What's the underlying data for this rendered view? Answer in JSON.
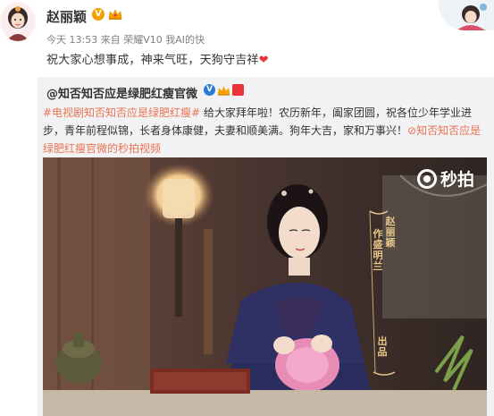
{
  "post": {
    "username": "赵丽颖",
    "verified_symbol": "V",
    "meta": "今天 13:53 来自 荣耀V10 我AI的快",
    "text": "祝大家心想事成，神来气旺，天狗守吉祥",
    "heart": "❤"
  },
  "repost": {
    "username": "@知否知否应是绿肥红瘦官微",
    "verified_symbol": "V",
    "tags": "#电视剧知否知否应是绿肥红瘦#",
    "body": " 给大家拜年啦！农历新年，阖家团圆，祝各位少年学业进步，青年前程似锦，长者身体康健，夫妻和顺美满。狗年大吉，家和万事兴！",
    "link": "知否知否应是绿肥红瘦官微的秒拍视频",
    "link_icon": "⊘"
  },
  "video": {
    "platform_label": "秒拍",
    "watermark_col1": "赵丽颖",
    "watermark_col2": "作盛明兰",
    "watermark_col3": "出品"
  },
  "colors": {
    "accent_orange": "#eb7350",
    "verified_gold": "#f5a100",
    "verified_blue": "#2d7bd7",
    "repost_bg": "#f2f2f5"
  }
}
